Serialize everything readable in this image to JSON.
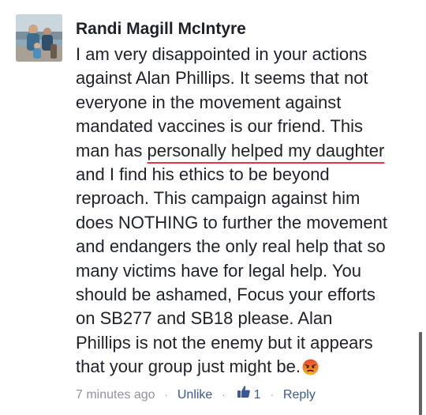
{
  "comment": {
    "author": "Randi Magill McIntyre",
    "lines": [
      "I am very disappointed in your actions",
      "against Alan Phillips. It seems that not",
      "everyone in the movement against",
      "mandated vaccines is our friend. This"
    ],
    "line5_prefix": "man has ",
    "line5_underlined": "personally helped my daughter",
    "lines_after": [
      "and I find his ethics to be beyond",
      "reproach. This campaign against him",
      "does NOTHING to further the movement",
      "and endangers the only real help that so",
      "many victims have for legal help. You",
      "should be ashamed, Focus your efforts",
      "on SB277 and SB18 please. Alan",
      "Phillips is not the enemy but it appears"
    ],
    "last_line": "that your group just might be.",
    "emoji_icon": "angry-face-icon"
  },
  "actions": {
    "timestamp": "7 minutes ago",
    "separator": "·",
    "unlike_label": "Unlike",
    "like_icon": "thumbs-up-icon",
    "like_count": "1",
    "reply_label": "Reply"
  },
  "colors": {
    "text": "#1d2129",
    "meta": "#90949c",
    "link": "#385898",
    "underline": "#e8334a"
  }
}
